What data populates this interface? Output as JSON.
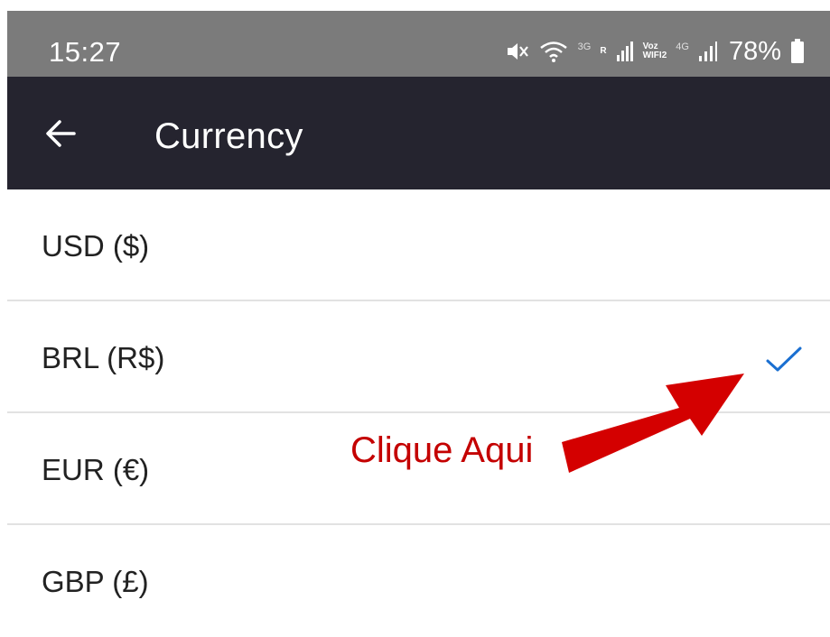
{
  "status_bar": {
    "time": "15:27",
    "network_3g": "3G",
    "roaming_r": "R",
    "voz_top": "Voz",
    "voz_bottom": "WIFI2",
    "network_4g": "4G",
    "battery": "78%"
  },
  "toolbar": {
    "title": "Currency",
    "back_icon": "arrow-left-icon"
  },
  "currency_list": {
    "items": [
      {
        "label": "USD ($)",
        "selected": false
      },
      {
        "label": "BRL (R$)",
        "selected": true
      },
      {
        "label": "EUR (€)",
        "selected": false
      },
      {
        "label": "GBP (£)",
        "selected": false
      }
    ]
  },
  "annotation": {
    "text": "Clique Aqui"
  },
  "colors": {
    "status_bar_bg": "#7b7b7b",
    "toolbar_bg": "#25242f",
    "check_color": "#1a6fd1",
    "annotation_red": "#c40000"
  }
}
